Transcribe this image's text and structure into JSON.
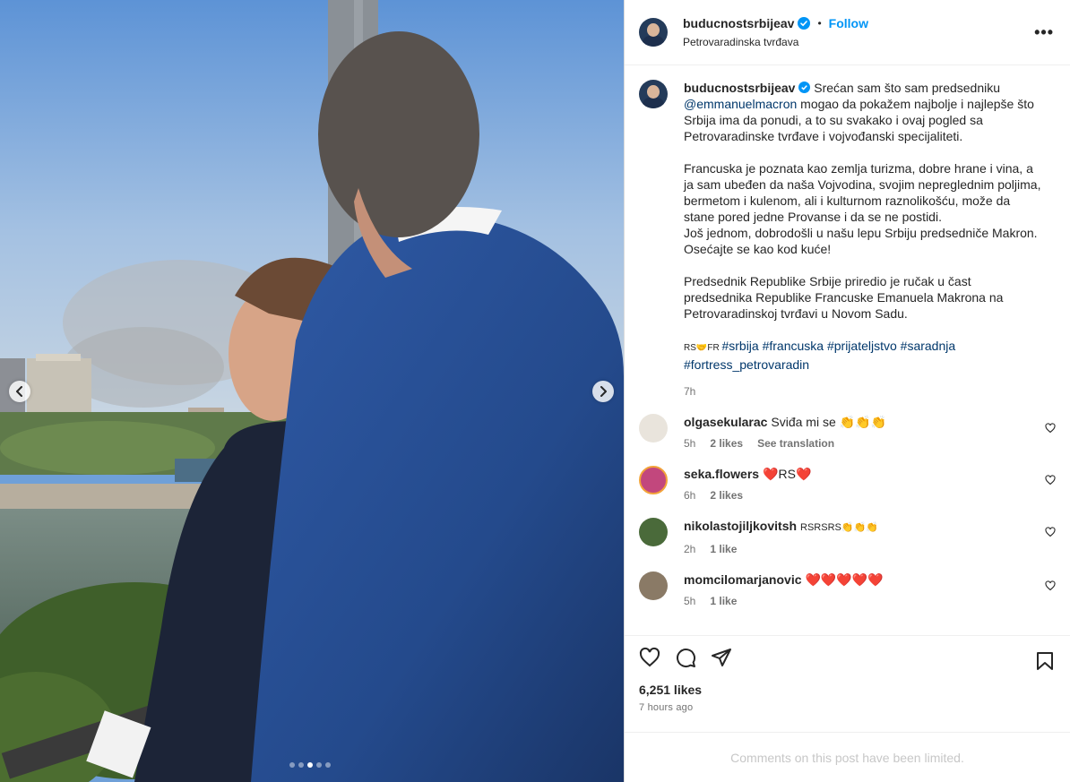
{
  "post": {
    "username": "buducnostsrbijeav",
    "follow_label": "Follow",
    "separator": "•",
    "location": "Petrovaradinska tvrđava",
    "more_label": "•••",
    "caption": {
      "username": "buducnostsrbijeav",
      "line1": "Srećan sam što sam predsedniku",
      "mention": "@emmanuelmacron",
      "line2": " mogao da pokažem najbolje i najlepše što Srbija ima da ponudi, a to su svakako i ovaj pogled sa Petrovaradinske tvrđave i vojvođanski specijaliteti.",
      "para2": "Francuska je poznata kao zemlja turizma, dobre hrane i vina, a ja sam ubeđen da naša Vojvodina, svojim nepreglednim poljima, bermetom i kulenom, ali i kulturnom raznolikošću, može da stane pored jedne Provanse i da se ne postidi.\nJoš jednom, dobrodošli u našu lepu Srbiju predsedniče Makron. Osećajte se kao kod kuće!",
      "para3": "Predsednik Republike Srbije priredio je ručak u čast predsednika Republike Francuske Emanuela Makrona na Petrovaradinskoj tvrđavi u Novom Sadu.",
      "flags_prefix": "RS🤝FR ",
      "hashtags": "#srbija #francuska #prijateljstvo #saradnja #fortress_petrovaradin",
      "time": "7h"
    },
    "comments": [
      {
        "username": "olgasekularac",
        "text": "Sviđa mi se 👏👏👏",
        "time": "5h",
        "likes": "2 likes",
        "extra": "See translation",
        "avatar_color": "#e9e4dc"
      },
      {
        "username": "seka.flowers",
        "text": "❤️RS❤️",
        "time": "6h",
        "likes": "2 likes",
        "extra": "",
        "avatar_color": "#c2477d"
      },
      {
        "username": "nikolastojiljkovitsh",
        "text": "RSRSRS👏👏👏",
        "time": "2h",
        "likes": "1 like",
        "extra": "",
        "avatar_color": "#4a6a3a"
      },
      {
        "username": "momcilomarjanovic",
        "text": "❤️❤️❤️❤️❤️",
        "time": "5h",
        "likes": "1 like",
        "extra": "",
        "avatar_color": "#8a7a66"
      }
    ],
    "likes_count": "6,251 likes",
    "posted_ago": "7 hours ago",
    "comments_limited": "Comments on this post have been limited.",
    "carousel": {
      "total": 5,
      "active_index": 2
    }
  },
  "icons": {
    "verified": "verified-badge-icon",
    "like": "heart-icon",
    "comment": "comment-icon",
    "share": "share-icon",
    "save": "bookmark-icon",
    "prev": "chevron-left-icon",
    "next": "chevron-right-icon"
  },
  "colors": {
    "accent": "#0095f6",
    "link": "#00376b",
    "muted": "#737373",
    "verified": "#0095f6"
  }
}
